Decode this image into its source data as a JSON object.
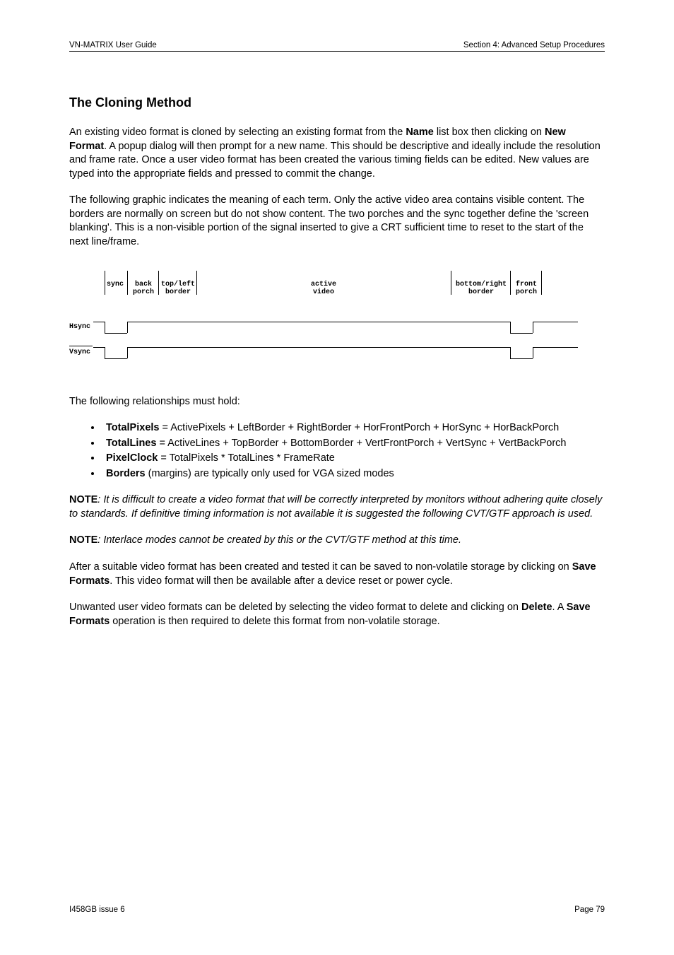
{
  "header": {
    "left": "VN-MATRIX User Guide",
    "right": "Section 4: Advanced Setup Procedures"
  },
  "title": "The Cloning Method",
  "para1_a": "An existing video format is cloned by selecting an existing format from the ",
  "para1_name": "Name",
  "para1_b": " list box then clicking on ",
  "para1_newformat": "New Format",
  "para1_c": ". A popup dialog will then prompt for a new name. This should be descriptive and ideally include the resolution and frame rate. Once a user video format has been created the various timing fields can be edited. New values are typed into the appropriate fields and pressed to commit the change.",
  "para2": "The following graphic indicates the meaning of each term. Only the active video area contains visible content. The borders are normally on screen but do not show content. The two porches and the sync together define the 'screen blanking'. This is a non-visible portion of the signal inserted to give a CRT sufficient time to reset to the start of the next line/frame.",
  "diagram": {
    "labels": {
      "sync": "sync",
      "back_porch_l1": "back",
      "back_porch_l2": "porch",
      "topleft_l1": "top/left",
      "topleft_l2": "border",
      "active_l1": "active",
      "active_l2": "video",
      "bottomright_l1": "bottom/right",
      "bottomright_l2": "border",
      "front_porch_l1": "front",
      "front_porch_l2": "porch"
    },
    "rows": {
      "hsync": "Hsync",
      "vsync": "Vsync"
    }
  },
  "rel_intro": "The following relationships must hold:",
  "bullets": [
    {
      "bold": "TotalPixels",
      "rest": " = ActivePixels + LeftBorder + RightBorder + HorFrontPorch + HorSync + HorBackPorch"
    },
    {
      "bold": "TotalLines",
      "rest": " = ActiveLines + TopBorder + BottomBorder + VertFrontPorch + VertSync + VertBackPorch"
    },
    {
      "bold": "PixelClock",
      "rest": " = TotalPixels * TotalLines * FrameRate"
    },
    {
      "bold": "Borders",
      "rest": " (margins) are typically only used for VGA sized modes"
    }
  ],
  "note_label": "NOTE",
  "note1": ": It is difficult to create a video format that will be correctly interpreted by monitors without adhering quite closely to standards. If definitive timing information is not available it is suggested the following CVT/GTF approach is used.",
  "note2": ": Interlace modes cannot be created by this or the CVT/GTF method at this time.",
  "para3_a": "After a suitable video format has been created and tested it can be saved to non-volatile storage by clicking on ",
  "para3_save": "Save Formats",
  "para3_b": ". This video format will then be available after a device reset or power cycle.",
  "para4_a": "Unwanted user video formats can be deleted by selecting the video format to delete and clicking on ",
  "para4_delete": "Delete",
  "para4_b": ". A ",
  "para4_save": "Save Formats",
  "para4_c": " operation is then required to delete this format from non-volatile storage.",
  "footer": {
    "left": "I458GB issue 6",
    "right": "Page 79"
  }
}
